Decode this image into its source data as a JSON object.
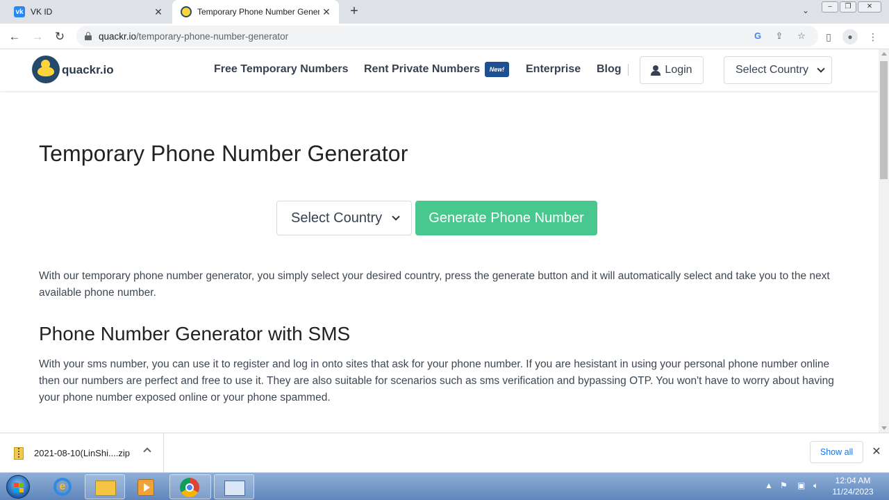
{
  "browser": {
    "tabs": [
      {
        "title": "VK ID",
        "favicon": "vk-icon"
      },
      {
        "title": "Temporary Phone Number Gener",
        "favicon": "quackr-icon"
      }
    ],
    "url_domain": "quackr.io",
    "url_path": "/temporary-phone-number-generator"
  },
  "site": {
    "logo_text": "quackr.io",
    "nav": {
      "free": "Free Temporary Numbers",
      "rent": "Rent Private Numbers",
      "new_badge": "New!",
      "enterprise": "Enterprise",
      "blog": "Blog",
      "login": "Login",
      "select_country": "Select Country"
    }
  },
  "main": {
    "title": "Temporary Phone Number Generator",
    "select_country": "Select Country",
    "generate_button": "Generate Phone Number",
    "intro": "With our temporary phone number generator, you simply select your desired country, press the generate button and it will automatically select and take you to the next available phone number.",
    "subheading": "Phone Number Generator with SMS",
    "body": "With your sms number, you can use it to register and log in onto sites that ask for your phone number. If you are hesistant in using your personal phone number online then our numbers are perfect and free to use it. They are also suitable for scenarios such as sms verification and bypassing OTP. You won't have to worry about having your phone number exposed online or your phone spammed."
  },
  "downloads": {
    "file_name": "2021-08-10(LinShi....zip",
    "show_all": "Show all"
  },
  "taskbar": {
    "time": "12:04 AM",
    "date": "11/24/2023"
  },
  "colors": {
    "generate_green": "#48c78e",
    "badge_blue": "#1d4f91",
    "logo_navy": "#24496b",
    "duck_yellow": "#ffd43b"
  }
}
